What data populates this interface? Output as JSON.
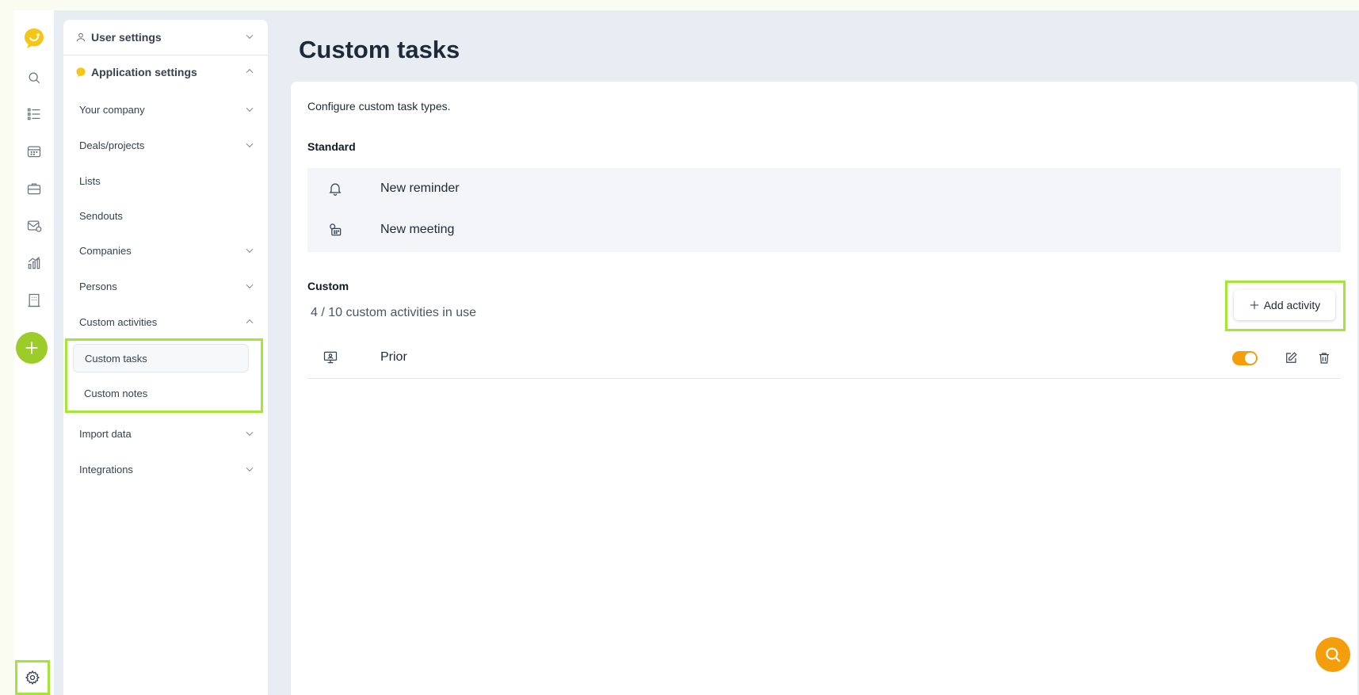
{
  "sidebar": {
    "user_settings": "User settings",
    "application_settings": "Application settings",
    "items": [
      {
        "label": "Your company"
      },
      {
        "label": "Deals/projects"
      },
      {
        "label": "Lists"
      },
      {
        "label": "Sendouts"
      },
      {
        "label": "Companies"
      },
      {
        "label": "Persons"
      },
      {
        "label": "Custom activities"
      },
      {
        "label": "Import data"
      },
      {
        "label": "Integrations"
      }
    ],
    "sub_items": [
      {
        "label": "Custom tasks",
        "active": true
      },
      {
        "label": "Custom notes",
        "active": false
      }
    ]
  },
  "main": {
    "title": "Custom tasks",
    "description": "Configure custom task types.",
    "standard_label": "Standard",
    "standard_items": [
      {
        "label": "New reminder",
        "icon": "bell-icon"
      },
      {
        "label": "New meeting",
        "icon": "meeting-icon"
      }
    ],
    "custom_label": "Custom",
    "usage": "4 / 10 custom activities in use",
    "add_button": "Add activity",
    "custom_items": [
      {
        "label": "Prior",
        "icon": "presentation-icon",
        "enabled": true
      }
    ]
  },
  "colors": {
    "accent_green": "#9ccc2a",
    "highlight": "#a3e635",
    "toggle_on": "#f59e0b",
    "search_fab": "#f59e0b"
  }
}
